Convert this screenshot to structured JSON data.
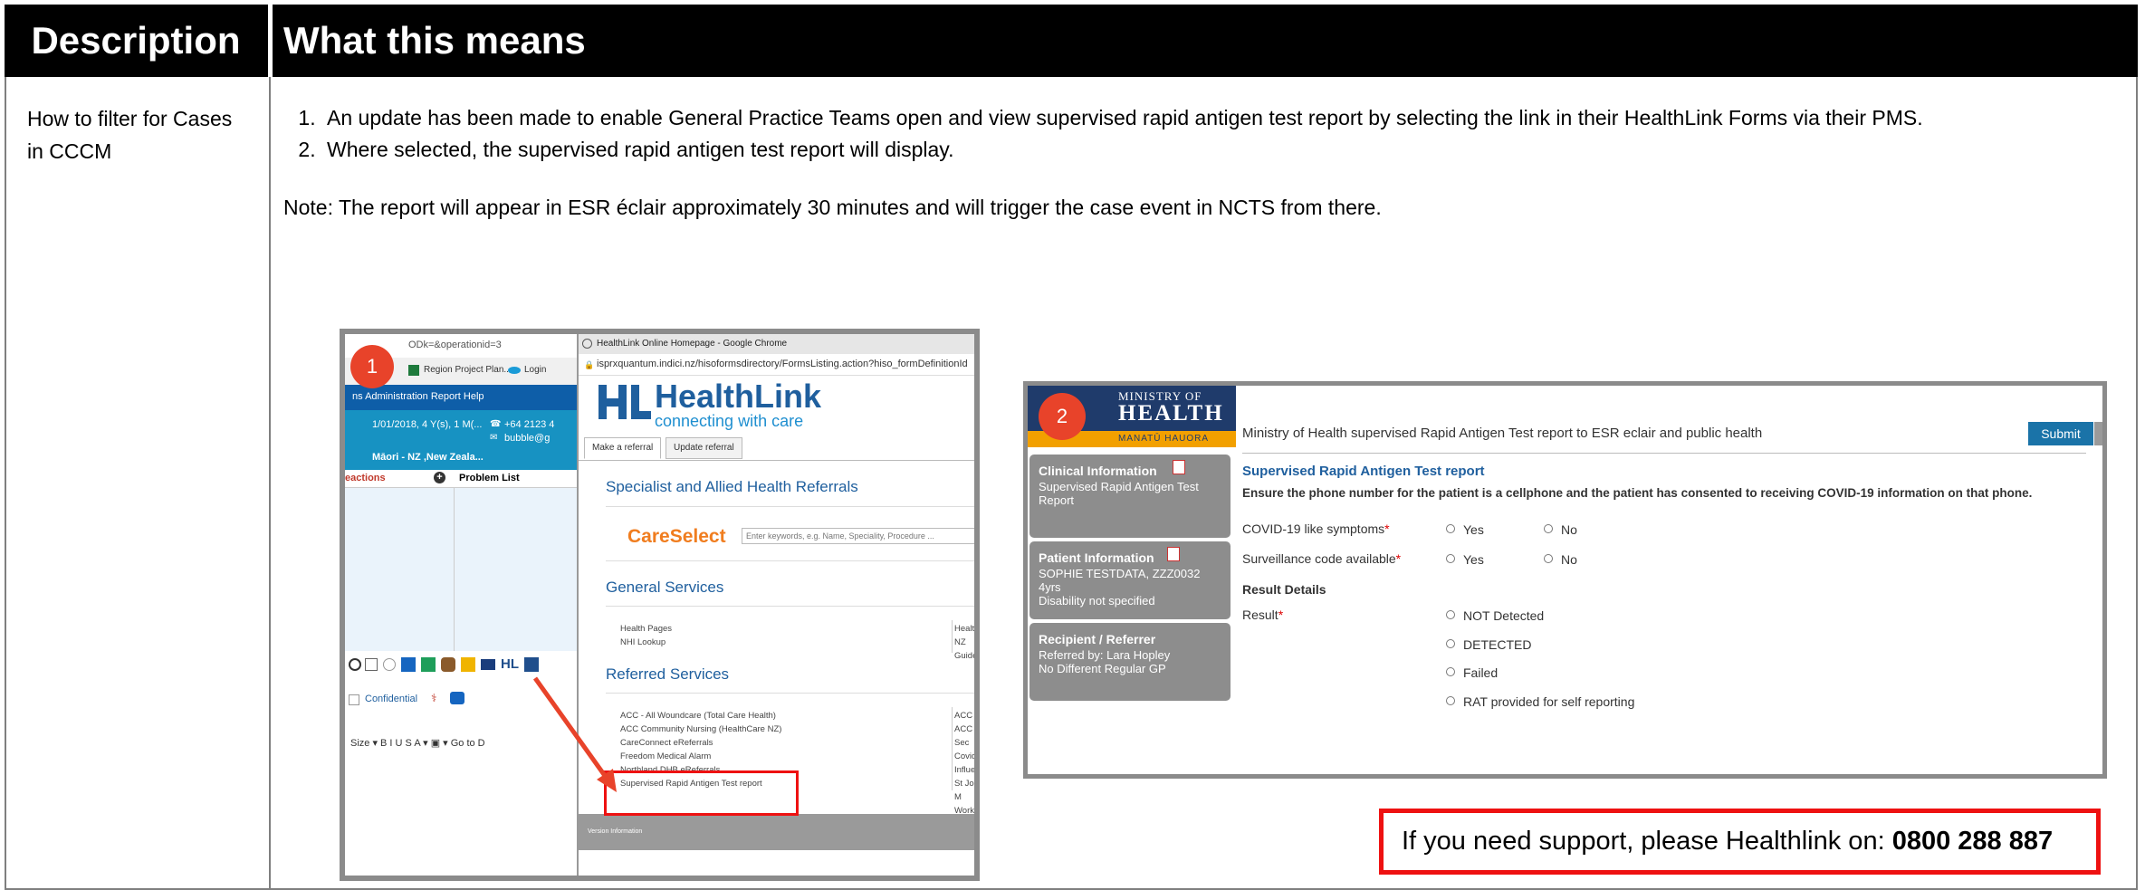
{
  "table": {
    "header": {
      "description": "Description",
      "meaning": "What this means"
    },
    "row": {
      "description": "How to filter for Cases in CCCM",
      "items": [
        "An update has been made to enable General Practice Teams open and view supervised rapid antigen test report by selecting the link in their HealthLink Forms via their PMS.",
        "Where selected, the supervised rapid antigen test report will display."
      ],
      "note": "Note:  The report will appear in ESR éclair approximately 30 minutes and will trigger the case event in NCTS from there."
    }
  },
  "screenshot1": {
    "badge": "1",
    "pms": {
      "url_text": "ODk=&operationid=3",
      "bookmarks": [
        "Region Project Plan...",
        "Login"
      ],
      "menu": "ns  Administration   Report   Help",
      "patient_line1": "1/01/2018, 4 Y(s), 1 M(...",
      "patient_phone": "+64 2123 4",
      "patient_email": "bubble@g",
      "patient_line2": "Māori - NZ ,New Zeala...",
      "list_left": "eactions",
      "list_right": "Problem List",
      "confidential": "Confidential",
      "editor": "Size  ▾  B  I  U  S   A ▾  ▣ ▾   Go to D"
    },
    "browser": {
      "title": "HealthLink Online Homepage - Google Chrome",
      "url": "isprxquantum.indici.nz/hisoformsdirectory/FormsListing.action?hiso_formDefinitionId",
      "logo_name": "HealthLink",
      "logo_tag": "connecting with care",
      "tabs": [
        "Make a referral",
        "Update referral"
      ],
      "section_specialist": "Specialist and Allied Health Referrals",
      "careselect": "CareSelect",
      "search_placeholder": "Enter keywords, e.g. Name, Speciality, Procedure ...",
      "section_general": "General Services",
      "general_left": [
        "Health Pages",
        "NHI Lookup"
      ],
      "general_right": [
        "Healthpo",
        "NZ Guide"
      ],
      "section_referred": "Referred Services",
      "referred_left": [
        "ACC - All Woundcare (Total Care Health)",
        "ACC Community Nursing (HealthCare NZ)",
        "CareConnect eReferrals",
        "Freedom Medical Alarm",
        "Northland DHB eReferrals",
        "Supervised Rapid Antigen Test report"
      ],
      "referred_right": [
        "ACC Bur",
        "ACC Sec",
        "Covid Cli",
        "Influenza",
        "St John M",
        "Work and"
      ],
      "footer": "Version Information"
    }
  },
  "screenshot2": {
    "badge": "2",
    "logo_line1": "MINISTRY OF",
    "logo_line2": "HEALTH",
    "logo_line3": "MANATŪ HAUORA",
    "title": "Ministry of Health supervised Rapid Antigen Test report to ESR eclair and public health",
    "submit": "Submit",
    "sidebar": [
      {
        "title": "Clinical Information",
        "lines": [
          "Supervised Rapid Antigen Test",
          "Report"
        ]
      },
      {
        "title": "Patient Information",
        "lines": [
          "SOPHIE TESTDATA, ZZZ0032",
          "4yrs",
          "Disability not specified"
        ]
      },
      {
        "title": "Recipient / Referrer",
        "lines": [
          "Referred by: Lara Hopley",
          "No Different Regular GP"
        ]
      }
    ],
    "form_heading": "Supervised Rapid Antigen Test report",
    "instruction": "Ensure the phone number for the patient is a cellphone and the patient has consented to receiving COVID-19 information on that phone.",
    "q1_label": "COVID-19 like symptoms",
    "q2_label": "Surveillance code available",
    "yes": "Yes",
    "no": "No",
    "required_mark": "*",
    "result_details": "Result Details",
    "result_label": "Result",
    "result_options": [
      "NOT Detected",
      "DETECTED",
      "Failed",
      "RAT provided for self reporting"
    ]
  },
  "support": {
    "text": "If you need support, please Healthlink on: ",
    "phone": "0800 288 887"
  },
  "colors": {
    "header_bg": "#000000",
    "highlight_red": "#ee1111",
    "badge": "#e8432a",
    "submit_blue": "#1a73a8"
  }
}
